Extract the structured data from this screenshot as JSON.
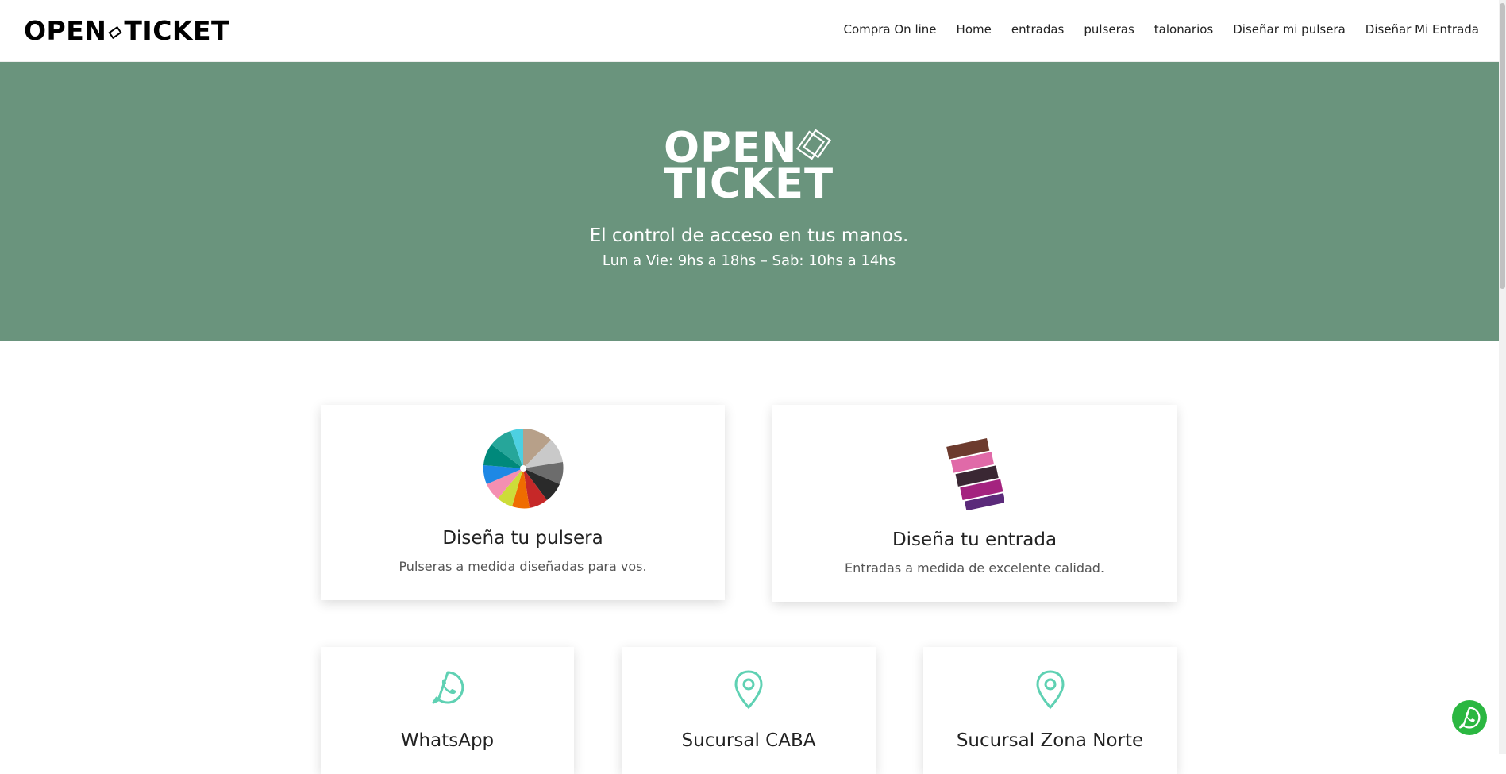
{
  "brand": {
    "logo_text_left": "OPEN",
    "logo_text_right": "TICKET"
  },
  "nav": [
    {
      "label": "Compra On line"
    },
    {
      "label": "Home"
    },
    {
      "label": "entradas"
    },
    {
      "label": "pulseras"
    },
    {
      "label": "talonarios"
    },
    {
      "label": "Diseñar mi pulsera"
    },
    {
      "label": "Diseñar Mi Entrada"
    }
  ],
  "hero": {
    "logo_line1": "OPEN",
    "logo_line2": "TICKET",
    "tagline": "El control de acceso en tus manos.",
    "hours": "Lun a Vie: 9hs a 18hs – Sab: 10hs a 14hs",
    "background_color": "#6a947d"
  },
  "features": [
    {
      "title": "Diseña tu pulsera",
      "description": "Pulseras a medida diseñadas para vos.",
      "icon": "wristband-color-fan-image"
    },
    {
      "title": "Diseña tu entrada",
      "description": "Entradas a medida de excelente calidad.",
      "icon": "printed-tickets-image"
    }
  ],
  "contacts": [
    {
      "title": "WhatsApp",
      "icon": "whatsapp-icon"
    },
    {
      "title": "Sucursal CABA",
      "icon": "map-pin-icon"
    },
    {
      "title": "Sucursal Zona Norte",
      "icon": "map-pin-icon"
    }
  ],
  "accent_color": "#5fd1b3",
  "whatsapp_float_color": "#2bb741"
}
